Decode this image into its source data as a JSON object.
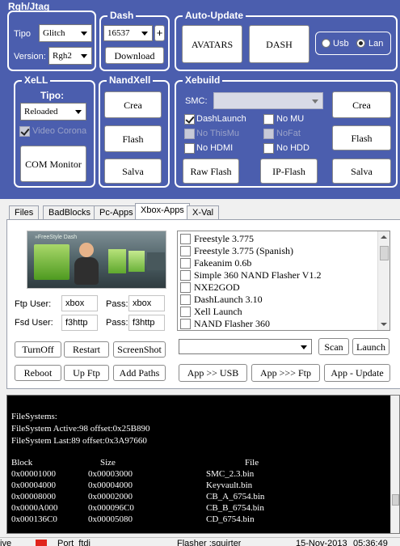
{
  "groups": {
    "rgh": "Rgh/Jtag",
    "dash": "Dash",
    "autoupdate": "Auto-Update",
    "xell": "XeLL",
    "nandxell": "NandXell",
    "xebuild": "Xebuild"
  },
  "rgh": {
    "tipo_label": "Tipo",
    "tipo_value": "Glitch",
    "version_label": "Version:",
    "version_value": "Rgh2"
  },
  "dash": {
    "value": "16537",
    "plus": "+",
    "download": "Download"
  },
  "autoupdate": {
    "avatars": "AVATARS",
    "dash": "DASH",
    "usb": "Usb",
    "lan": "Lan"
  },
  "xell": {
    "tipo_label": "Tipo:",
    "tipo_value": "Reloaded",
    "video_label": "Video Corona",
    "com_monitor": "COM Monitor"
  },
  "nandxell": {
    "crea": "Crea",
    "flash": "Flash",
    "salva": "Salva"
  },
  "xebuild": {
    "smc_label": "SMC:",
    "dashlaunch": "DashLaunch",
    "no_mu": "No MU",
    "no_writemu": "No ThisMu",
    "nofat": "NoFat",
    "no_hdmi": "No HDMI",
    "no_hdd": "No HDD",
    "raw_flash": "Raw Flash",
    "ip_flash": "IP-Flash",
    "crea": "Crea",
    "flash": "Flash",
    "salva": "Salva"
  },
  "tabs": [
    "Files",
    "BadBlocks",
    "Pc-Apps",
    "Xbox-Apps",
    "X-Val"
  ],
  "xbox_apps": {
    "preview_text": "»FreeStyle Dash",
    "ftp_user_label": "Ftp User:",
    "ftp_user": "xbox",
    "ftp_pass_label": "Pass:",
    "ftp_pass": "xbox",
    "fsd_user_label": "Fsd User:",
    "fsd_user": "f3http",
    "fsd_pass_label": "Pass:",
    "fsd_pass": "f3http",
    "apps": [
      "Freestyle 3.775",
      "Freestyle 3.775 (Spanish)",
      "Fakeanim 0.6b",
      "Simple 360 NAND Flasher V1.2",
      "NXE2GOD",
      "DashLaunch 3.10",
      "Xell Launch",
      "NAND Flasher 360"
    ],
    "turnoff": "TurnOff",
    "restart": "Restart",
    "screenshot": "ScreenShot",
    "reboot": "Reboot",
    "up_ftp": "Up Ftp",
    "add_paths": "Add Paths",
    "scan": "Scan",
    "launch": "Launch",
    "app_usb": "App >> USB",
    "app_ftp": "App >>> Ftp",
    "app_update": "App - Update"
  },
  "log": {
    "lines": [
      "FileSystems:",
      "FileSystem Active:98 offset:0x25B890",
      "FileSystem Last:89 offset:0x3A97660"
    ],
    "headers": [
      "Block",
      "Size",
      "File"
    ],
    "rows": [
      [
        "0x00001000",
        "0x00003000",
        "SMC_2.3.bin"
      ],
      [
        "0x00004000",
        "0x00004000",
        "Keyvault.bin"
      ],
      [
        "0x00008000",
        "0x00002000",
        "CB_A_6754.bin"
      ],
      [
        "0x0000A000",
        "0x000096C0",
        "CB_B_6754.bin"
      ],
      [
        "0x000136C0",
        "0x00005080",
        "CD_6754.bin"
      ]
    ]
  },
  "status": {
    "mode": "ive",
    "port": "Port_ftdi",
    "flasher": "Flasher :squirter",
    "date": "15-Nov-2013",
    "time": "05:36:49"
  },
  "colors": {
    "background": "#4b5eae",
    "status_red": "#e0241c"
  }
}
